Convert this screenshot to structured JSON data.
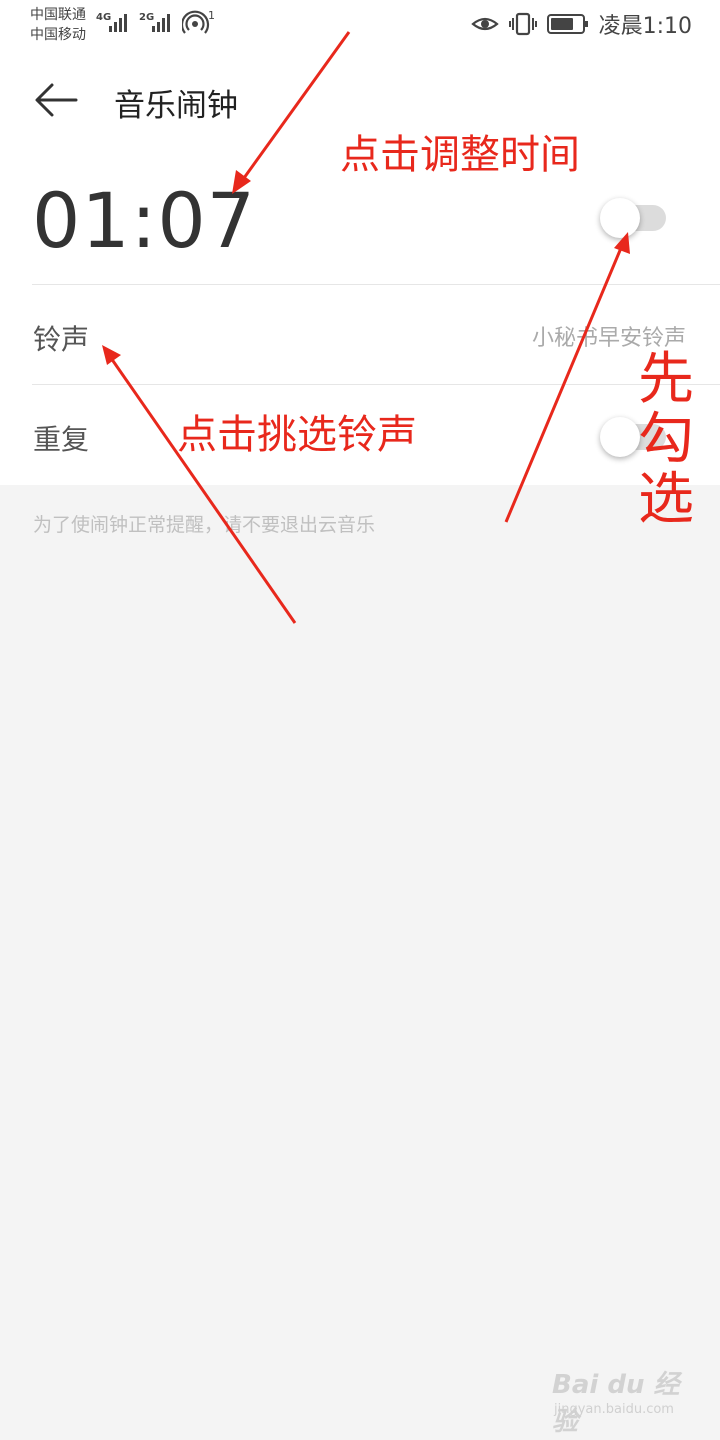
{
  "status_bar": {
    "carrier_1": "中国联通",
    "carrier_2": "中国移动",
    "signal_1_type": "4G",
    "signal_2_type": "2G",
    "hotspot_count": "1",
    "time": "凌晨1:10"
  },
  "header": {
    "back_icon": "back-arrow-icon",
    "title": "音乐闹钟"
  },
  "alarm": {
    "time": "01:07",
    "enabled": false
  },
  "ringtone": {
    "label": "铃声",
    "value": "小秘书早安铃声"
  },
  "repeat": {
    "label": "重复",
    "enabled": false
  },
  "hint": "为了使闹钟正常提醒，请不要退出云音乐",
  "annotations": {
    "adjust_time": "点击调整时间",
    "pick_ringtone": "点击挑选铃声",
    "check_first": "先勾选"
  },
  "watermark": {
    "main": "Bai du 经验",
    "sub": "jingyan.baidu.com"
  },
  "colors": {
    "annotation": "#e8281c",
    "background": "#f4f4f4",
    "panel": "#ffffff",
    "toggle_off": "#dcdcdc"
  }
}
